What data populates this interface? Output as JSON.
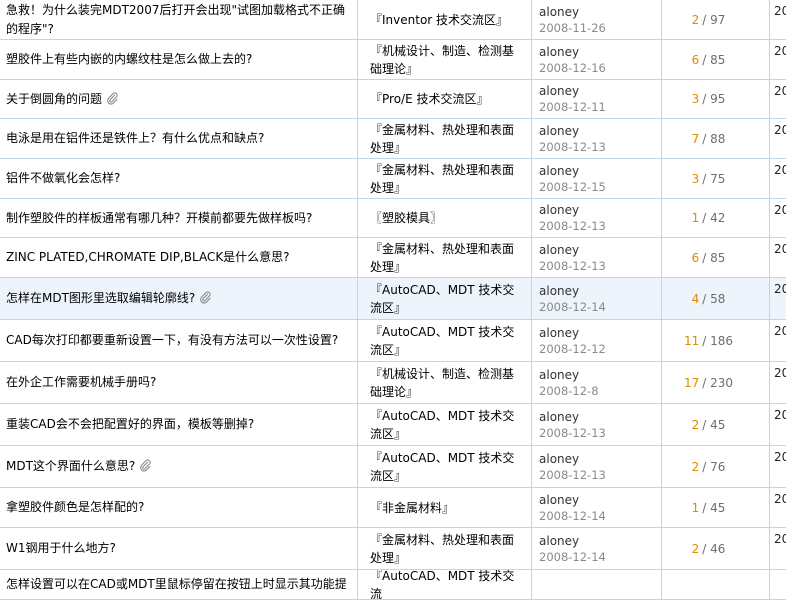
{
  "threads": [
    {
      "title": "急救！为什么装完MDT2007后打开会出现\"试图加载格式不正确的程序\"?",
      "clip": false,
      "forum": "『Inventor 技术交流区』",
      "author": "aloney",
      "date": "2008-11-26",
      "replies": "2",
      "views": "/ 97",
      "last": "20"
    },
    {
      "title": "塑胶件上有些内嵌的内螺纹柱是怎么做上去的?",
      "clip": false,
      "forum": "『机械设计、制造、检测基础理论』",
      "author": "aloney",
      "date": "2008-12-16",
      "replies": "6",
      "views": "/ 85",
      "last": "20"
    },
    {
      "title": "关于倒圆角的问题",
      "clip": true,
      "forum": "『Pro/E 技术交流区』",
      "author": "aloney",
      "date": "2008-12-11",
      "replies": "3",
      "views": "/ 95",
      "last": "20"
    },
    {
      "title": "电泳是用在铝件还是铁件上？有什么优点和缺点?",
      "clip": false,
      "forum": "『金属材料、热处理和表面处理』",
      "author": "aloney",
      "date": "2008-12-13",
      "replies": "7",
      "views": "/ 88",
      "last": "20"
    },
    {
      "title": "铝件不做氧化会怎样?",
      "clip": false,
      "forum": "『金属材料、热处理和表面处理』",
      "author": "aloney",
      "date": "2008-12-15",
      "replies": "3",
      "views": "/ 75",
      "last": "20"
    },
    {
      "title": "制作塑胶件的样板通常有哪几种？开模前都要先做样板吗?",
      "clip": false,
      "forum": "〖塑胶模具〗",
      "author": "aloney",
      "date": "2008-12-13",
      "replies": "1",
      "views": "/ 42",
      "last": "20"
    },
    {
      "title": "ZINC PLATED,CHROMATE DIP,BLACK是什么意思?",
      "clip": false,
      "forum": "『金属材料、热处理和表面处理』",
      "author": "aloney",
      "date": "2008-12-13",
      "replies": "6",
      "views": "/ 85",
      "last": "20"
    },
    {
      "title": "怎样在MDT图形里选取编辑轮廓线?",
      "clip": true,
      "forum": "『AutoCAD、MDT 技术交流区』",
      "author": "aloney",
      "date": "2008-12-14",
      "replies": "4",
      "views": "/ 58",
      "last": "20",
      "highlight": true
    },
    {
      "title": "CAD每次打印都要重新设置一下，有没有方法可以一次性设置?",
      "clip": false,
      "forum": "『AutoCAD、MDT 技术交流区』",
      "author": "aloney",
      "date": "2008-12-12",
      "replies": "11",
      "views": "/ 186",
      "last": "20"
    },
    {
      "title": "在外企工作需要机械手册吗?",
      "clip": false,
      "forum": "『机械设计、制造、检测基础理论』",
      "author": "aloney",
      "date": "2008-12-8",
      "replies": "17",
      "views": "/ 230",
      "last": "20"
    },
    {
      "title": "重装CAD会不会把配置好的界面，模板等删掉?",
      "clip": false,
      "forum": "『AutoCAD、MDT 技术交流区』",
      "author": "aloney",
      "date": "2008-12-13",
      "replies": "2",
      "views": "/ 45",
      "last": "20"
    },
    {
      "title": "MDT这个界面什么意思?",
      "clip": true,
      "forum": "『AutoCAD、MDT 技术交流区』",
      "author": "aloney",
      "date": "2008-12-13",
      "replies": "2",
      "views": "/ 76",
      "last": "20"
    },
    {
      "title": "拿塑胶件颜色是怎样配的?",
      "clip": false,
      "forum": "『非金属材料』",
      "author": "aloney",
      "date": "2008-12-14",
      "replies": "1",
      "views": "/ 45",
      "last": "20"
    },
    {
      "title": "W1钢用于什么地方?",
      "clip": false,
      "forum": "『金属材料、热处理和表面处理』",
      "author": "aloney",
      "date": "2008-12-14",
      "replies": "2",
      "views": "/ 46",
      "last": "20"
    },
    {
      "title": "怎样设置可以在CAD或MDT里鼠标停留在按钮上时显示其功能提",
      "clip": false,
      "forum": "『AutoCAD、MDT 技术交流",
      "author": "",
      "date": "",
      "replies": "",
      "views": "",
      "last": ""
    }
  ]
}
